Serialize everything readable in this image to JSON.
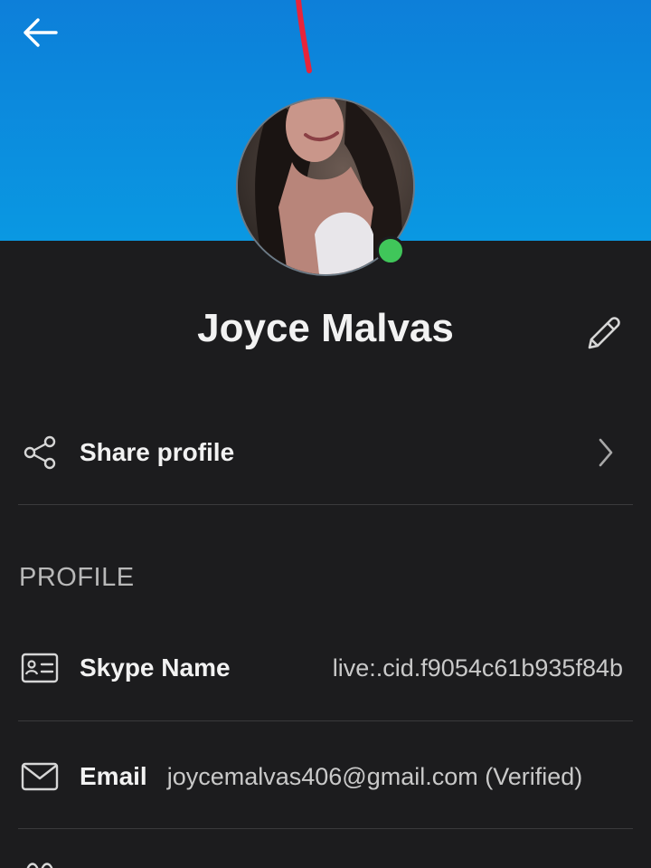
{
  "header": {
    "back_icon": "arrow-left-icon",
    "background_colors": [
      "#0d7fd9",
      "#0a98e2"
    ]
  },
  "profile_header": {
    "display_name": "Joyce Malvas",
    "online_status_color": "#40c65a",
    "edit_icon": "pencil-icon"
  },
  "share": {
    "label": "Share profile",
    "icon": "share-icon",
    "chevron_icon": "chevron-right-icon"
  },
  "section": {
    "title": "PROFILE"
  },
  "fields": {
    "skype_name": {
      "label": "Skype Name",
      "value": "live:.cid.f9054c61b935f84b",
      "icon": "id-card-icon"
    },
    "email": {
      "label": "Email",
      "value": "joycemalvas406@gmail.com  (Verified)",
      "icon": "mail-icon"
    }
  }
}
